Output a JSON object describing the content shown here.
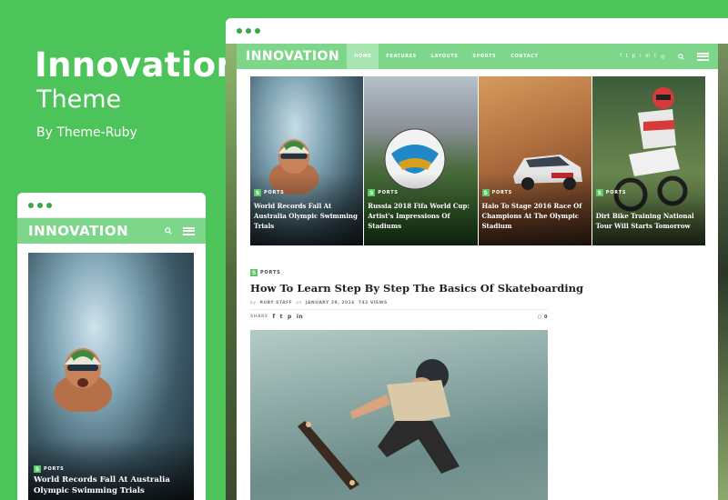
{
  "promo": {
    "title": "Innovation",
    "subtitle": "Theme",
    "byline": "By Theme-Ruby"
  },
  "brand": {
    "logo": "INNOVATION",
    "accent": "#4cc45a",
    "nav_bg": "#7dd68a"
  },
  "desktop": {
    "menu": [
      "HOME",
      "FEATURES",
      "LAYOUTS",
      "SPORTS",
      "CONTACT"
    ],
    "active_menu": "HOME",
    "social_icons": [
      "f",
      "t",
      "p",
      "i",
      "in",
      "t",
      "rss"
    ],
    "tiles": [
      {
        "category": "PORTS",
        "title": "World Records Fall At Australia Olympic Swimming Trials"
      },
      {
        "category": "PORTS",
        "title": "Russia 2018 Fifa World Cup: Artist's Impressions Of Stadiums"
      },
      {
        "category": "PORTS",
        "title": "Halo To Stage 2016 Race Of Champions At The Olympic Stadium"
      },
      {
        "category": "PORTS",
        "title": "Dirt Bike Training National Tour Will Starts Tomorrow"
      }
    ],
    "post": {
      "category": "PORTS",
      "title": "How To Learn Step By Step The Basics Of Skateboarding",
      "by": "by",
      "author": "RUBY STAFF",
      "on": "on",
      "date": "JANUARY 29, 2016",
      "views": "742 VIEWS",
      "share_label": "SHARE",
      "comments": "0"
    }
  },
  "mobile": {
    "card": {
      "category": "PORTS",
      "title": "World Records Fall At Australia Olympic Swimming Trials"
    }
  },
  "tag_letter": "S"
}
